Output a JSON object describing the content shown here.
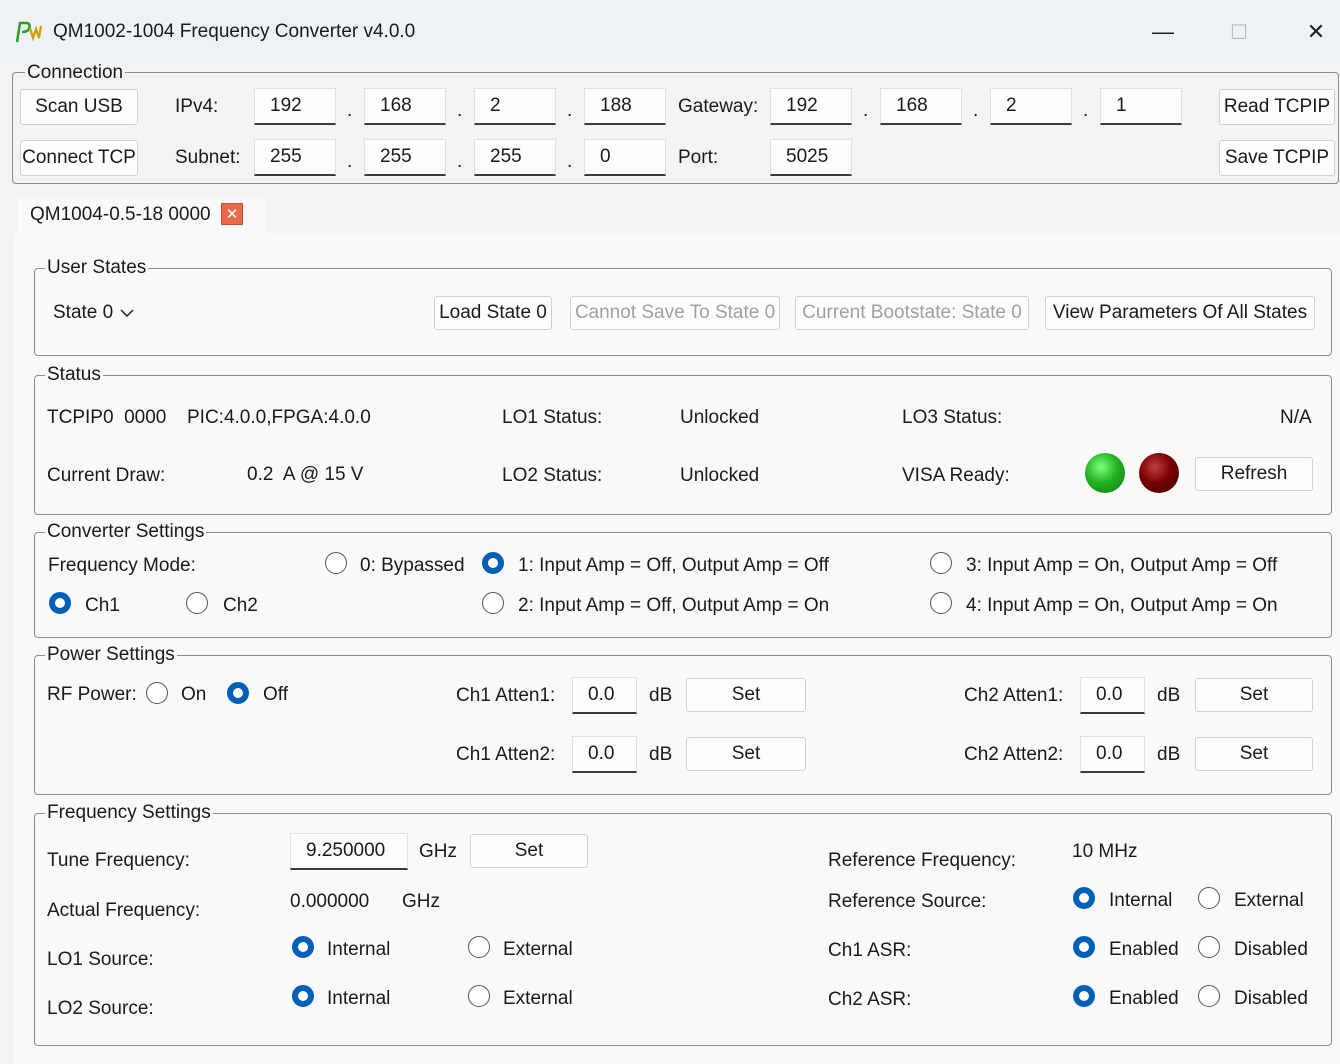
{
  "window": {
    "title": "QM1002-1004 Frequency Converter v4.0.0",
    "minimize": "—",
    "maximize": "☐",
    "close": "✕"
  },
  "connection": {
    "legend": "Connection",
    "scan_usb": "Scan USB",
    "connect_tcp": "Connect TCP",
    "ipv4_label": "IPv4:",
    "ipv4": [
      "192",
      "168",
      "2",
      "188"
    ],
    "subnet_label": "Subnet:",
    "subnet": [
      "255",
      "255",
      "255",
      "0"
    ],
    "gateway_label": "Gateway:",
    "gateway": [
      "192",
      "168",
      "2",
      "1"
    ],
    "port_label": "Port:",
    "port": "5025",
    "dot": ".",
    "read_tcpip": "Read TCPIP",
    "save_tcpip": "Save TCPIP"
  },
  "tab": {
    "label": "QM1004-0.5-18 0000",
    "close": "✕"
  },
  "user_states": {
    "legend": "User States",
    "state_select": "State 0",
    "load_state": "Load State 0",
    "cannot_save": "Cannot Save To State 0",
    "current_bootstate": "Current Bootstate: State 0",
    "view_params": "View Parameters Of All States"
  },
  "status": {
    "legend": "Status",
    "device": "TCPIP0  0000",
    "firmware": "PIC:4.0.0,FPGA:4.0.0",
    "current_draw_label": "Current Draw:",
    "current_draw_value": "0.2  A @ 15 V",
    "lo1_label": "LO1 Status:",
    "lo1_value": "Unlocked",
    "lo2_label": "LO2 Status:",
    "lo2_value": "Unlocked",
    "lo3_label": "LO3 Status:",
    "lo3_value": "N/A",
    "visa_label": "VISA Ready:",
    "refresh": "Refresh",
    "colors": {
      "led_green": "#22b422",
      "led_red": "#7a0000"
    }
  },
  "converter": {
    "legend": "Converter Settings",
    "freq_mode_label": "Frequency Mode:",
    "ch1": "Ch1",
    "ch2": "Ch2",
    "mode0": "0: Bypassed",
    "mode1": "1: Input Amp = Off, Output Amp = Off",
    "mode2": "2: Input Amp = Off, Output Amp = On",
    "mode3": "3: Input Amp = On, Output Amp = Off",
    "mode4": "4: Input Amp = On, Output Amp = On"
  },
  "power": {
    "legend": "Power Settings",
    "rf_power_label": "RF Power:",
    "on": "On",
    "off": "Off",
    "ch1_atten1_label": "Ch1 Atten1:",
    "ch1_atten1": "0.0",
    "ch1_atten2_label": "Ch1 Atten2:",
    "ch1_atten2": "0.0",
    "ch2_atten1_label": "Ch2 Atten1:",
    "ch2_atten1": "0.0",
    "ch2_atten2_label": "Ch2 Atten2:",
    "ch2_atten2": "0.0",
    "db": "dB",
    "set": "Set"
  },
  "frequency": {
    "legend": "Frequency Settings",
    "tune_label": "Tune Frequency:",
    "tune_value": "9.250000",
    "ghz": "GHz",
    "set": "Set",
    "actual_label": "Actual Frequency:",
    "actual_value": "0.000000",
    "lo1_source_label": "LO1 Source:",
    "lo2_source_label": "LO2 Source:",
    "internal": "Internal",
    "external": "External",
    "ref_freq_label": "Reference Frequency:",
    "ref_freq_value": "10 MHz",
    "ref_source_label": "Reference Source:",
    "ch1_asr_label": "Ch1 ASR:",
    "ch2_asr_label": "Ch2 ASR:",
    "enabled": "Enabled",
    "disabled": "Disabled"
  }
}
